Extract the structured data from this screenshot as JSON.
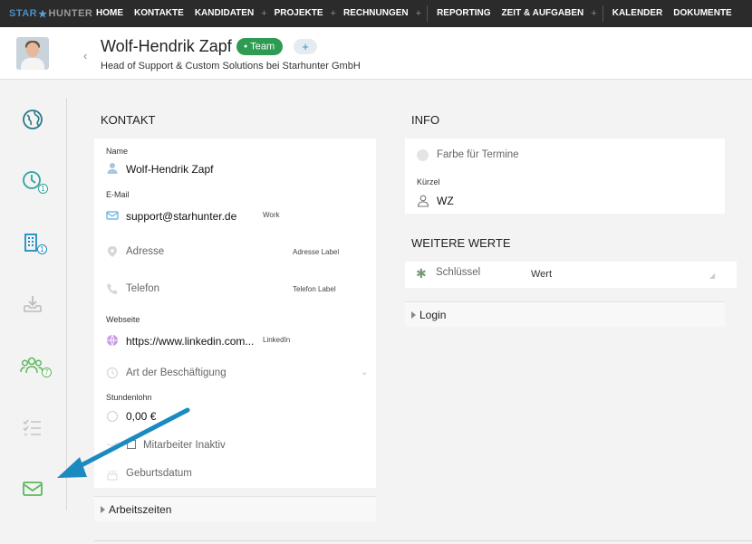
{
  "nav": {
    "logo_part1": "STAR",
    "logo_part2": "HUNTER",
    "items": [
      {
        "label": "HOME",
        "plus": false
      },
      {
        "label": "KONTAKTE",
        "plus": false
      },
      {
        "label": "KANDIDATEN",
        "plus": true
      },
      {
        "label": "PROJEKTE",
        "plus": true
      },
      {
        "label": "RECHNUNGEN",
        "plus": true
      },
      {
        "label": "REPORTING",
        "plus": false
      },
      {
        "label": "ZEIT & AUFGABEN",
        "plus": true
      },
      {
        "label": "KALENDER",
        "plus": false
      },
      {
        "label": "DOKUMENTE",
        "plus": false
      }
    ]
  },
  "header": {
    "name": "Wolf-Hendrik Zapf",
    "badge": "Team",
    "plus": "+",
    "subtitle": "Head of Support & Custom Solutions bei Starhunter GmbH"
  },
  "sidebar": {
    "badges": [
      "1",
      "1",
      "7"
    ]
  },
  "kontakt": {
    "title": "KONTAKT",
    "name_label": "Name",
    "name_value": "Wolf-Hendrik Zapf",
    "email_label": "E-Mail",
    "email_value": "support@starhunter.de",
    "email_tag": "Work",
    "address_placeholder": "Adresse",
    "address_tag": "Adresse Label",
    "phone_placeholder": "Telefon",
    "phone_tag": "Telefon Label",
    "website_label": "Webseite",
    "website_value": "https://www.linkedin.com...",
    "website_tag": "LinkedIn",
    "employment_placeholder": "Art der Beschäftigung",
    "wage_label": "Stundenlohn",
    "wage_value": "0,00 €",
    "inactive_label": "Mitarbeiter Inaktiv",
    "birthday_placeholder": "Geburtsdatum",
    "worktimes": "Arbeitszeiten"
  },
  "info": {
    "title": "INFO",
    "color_placeholder": "Farbe für Termine",
    "short_label": "Kürzel",
    "short_value": "WZ"
  },
  "weitere": {
    "title": "WEITERE WERTE",
    "key_placeholder": "Schlüssel",
    "value_placeholder": "Wert",
    "login": "Login"
  },
  "colors": {
    "nav_bg": "#2b2b2b",
    "badge_green": "#2f9a52",
    "accent_blue": "#1c8bc1",
    "icon_green": "#5cb85c",
    "icon_teal": "#2a7a8a"
  }
}
